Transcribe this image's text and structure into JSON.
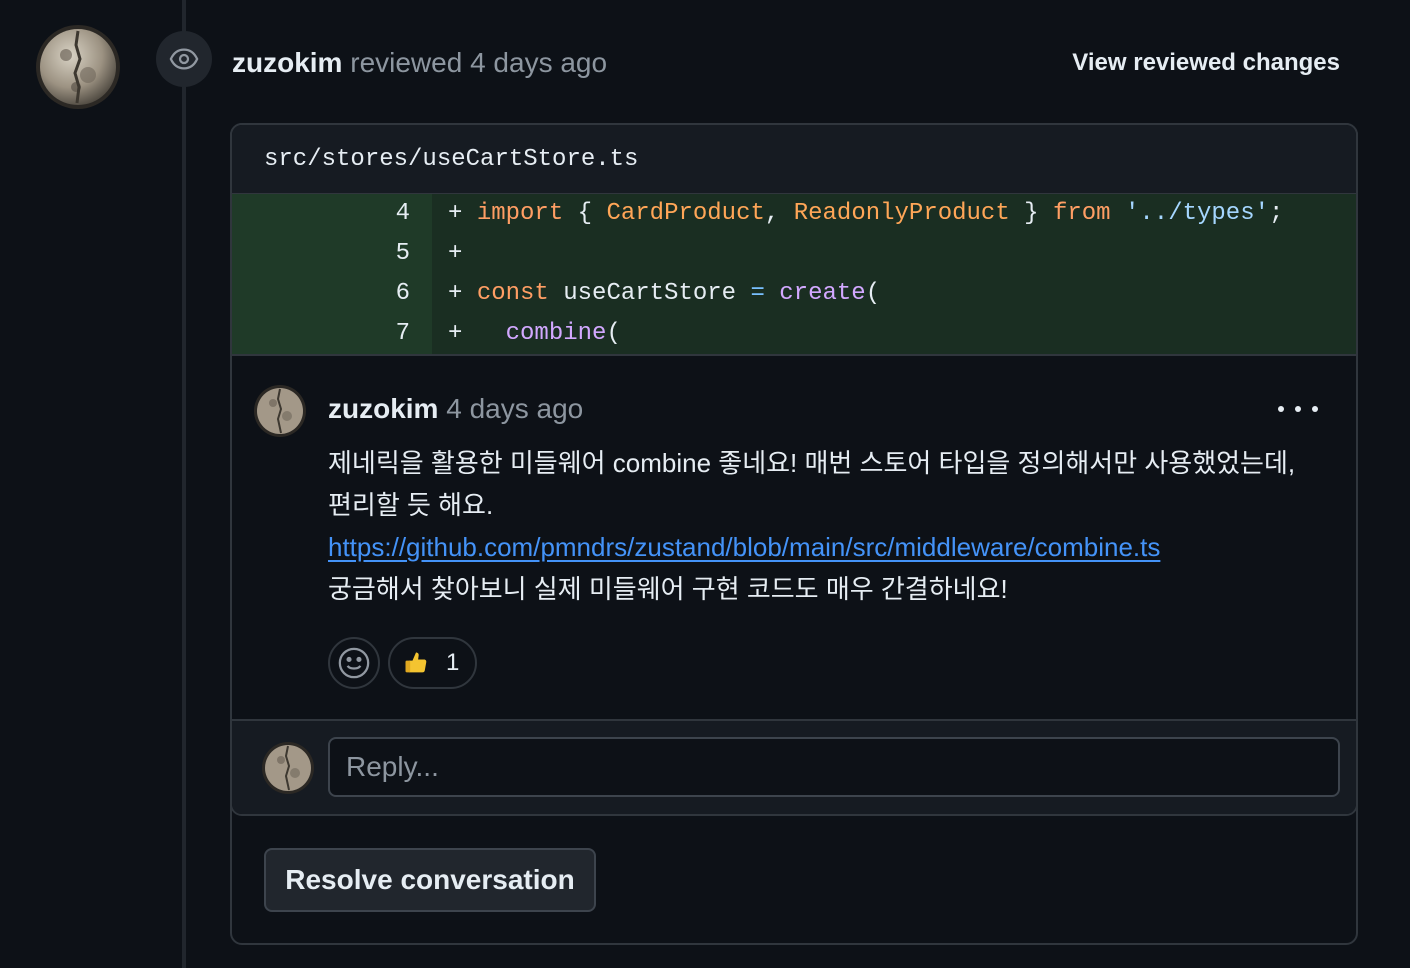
{
  "review": {
    "author": "zuzokim",
    "action_text": "reviewed 4 days ago",
    "view_changes_label": "View reviewed changes",
    "icon": "eye-icon"
  },
  "thread": {
    "file_path": "src/stores/useCartStore.ts",
    "diff_lines": [
      {
        "line": "4",
        "marker": "+"
      },
      {
        "line": "5",
        "marker": "+"
      },
      {
        "line": "6",
        "marker": "+"
      },
      {
        "line": "7",
        "marker": "+"
      }
    ],
    "code_tokens": {
      "l4_import": "import",
      "l4_brace_open": "{",
      "l4_type1": "CardProduct",
      "l4_comma": ",",
      "l4_type2": "ReadonlyProduct",
      "l4_brace_close": "}",
      "l4_from": "from",
      "l4_path": "'../types'",
      "l4_semi": ";",
      "l6_const": "const",
      "l6_name": "useCartStore",
      "l6_eq": "=",
      "l6_create": "create",
      "l6_paren": "(",
      "l7_combine": "combine",
      "l7_paren": "("
    }
  },
  "comment": {
    "author": "zuzokim",
    "time": "4 days ago",
    "body_line1": "제네릭을 활용한 미들웨어 combine 좋네요! 매번 스토어 타입을 정의해서만 사용했었는데,",
    "body_line2": "편리할 듯 해요.",
    "link": "https://github.com/pmndrs/zustand/blob/main/src/middleware/combine.ts",
    "body_line3": "궁금해서 찾아보니 실제 미들웨어 구현 코드도 매우 간결하네요!",
    "reactions": [
      {
        "emoji_name": "thumbs-up-icon",
        "count": "1"
      }
    ]
  },
  "reply": {
    "placeholder": "Reply..."
  },
  "resolve_label": "Resolve conversation",
  "colors": {
    "background": "#0d1117",
    "diff_added": "#1a2e22",
    "link": "#4493f8",
    "keyword": "#ff9e64",
    "string": "#a5d6ff",
    "function": "#d2a8ff"
  }
}
